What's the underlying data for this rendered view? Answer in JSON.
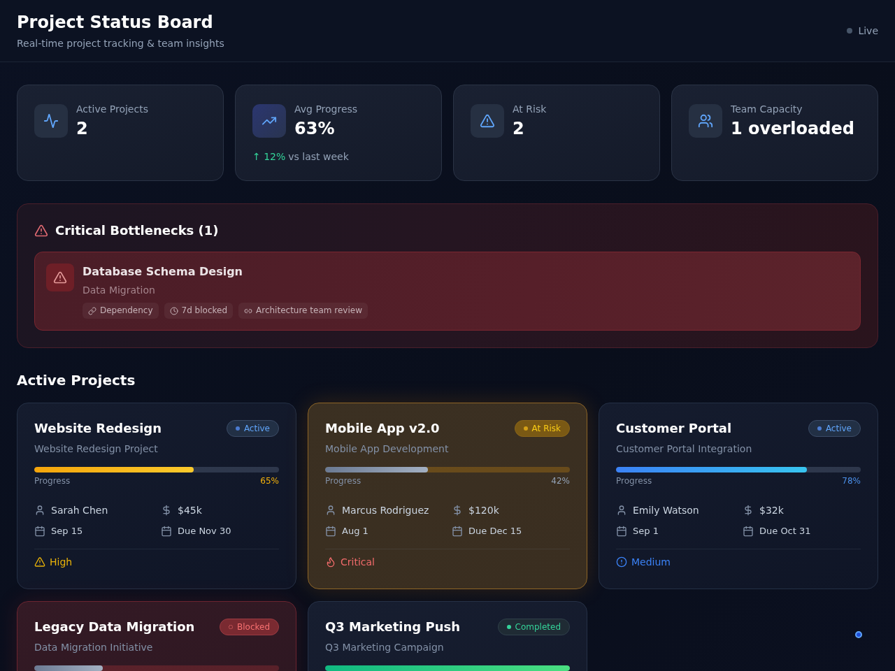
{
  "header": {
    "title": "Project Status Board",
    "subtitle": "Real-time project tracking & team insights",
    "live": {
      "label": "Live",
      "connected": false
    }
  },
  "stats": [
    {
      "kind": "projects",
      "label": "Active Projects",
      "value": "2"
    },
    {
      "kind": "progress",
      "label": "Avg Progress",
      "value": "63%",
      "trend": {
        "change": "↑ 12%",
        "note": "vs last week"
      }
    },
    {
      "kind": "risk",
      "label": "At Risk",
      "value": "2"
    },
    {
      "kind": "capacity",
      "label": "Team Capacity",
      "value": "1 overloaded"
    }
  ],
  "bottlenecks": {
    "title": "Critical Bottlenecks (1)",
    "items": [
      {
        "title": "Database Schema Design",
        "project": "Data Migration",
        "tags": [
          {
            "kind": "dependency",
            "label": "Dependency"
          },
          {
            "kind": "duration",
            "label": "7d blocked"
          },
          {
            "kind": "reviewer",
            "label": "Architecture team review"
          }
        ]
      }
    ]
  },
  "projects_section": {
    "title": "Active Projects",
    "projects": [
      {
        "name": "Website Redesign",
        "description": "Website Redesign Project",
        "status": {
          "kind": "active",
          "label": "Active"
        },
        "progress_label": "Progress",
        "level": 0.65,
        "percent": "65%",
        "owner": "Sarah Chen",
        "budget": "$45k",
        "start": "Sep 15",
        "due": "Due Nov 30",
        "priority": {
          "kind": "high",
          "label": "High"
        }
      },
      {
        "name": "Mobile App v2.0",
        "description": "Mobile App Development",
        "status": {
          "kind": "risk",
          "label": "At Risk"
        },
        "progress_label": "Progress",
        "level": 0.42,
        "percent": "42%",
        "owner": "Marcus Rodriguez",
        "budget": "$120k",
        "start": "Aug 1",
        "due": "Due Dec 15",
        "priority": {
          "kind": "critical",
          "label": "Critical"
        }
      },
      {
        "name": "Customer Portal",
        "description": "Customer Portal Integration",
        "status": {
          "kind": "active",
          "label": "Active"
        },
        "progress_label": "Progress",
        "level": 0.78,
        "percent": "78%",
        "owner": "Emily Watson",
        "budget": "$32k",
        "start": "Sep 1",
        "due": "Due Oct 31",
        "priority": {
          "kind": "medium",
          "label": "Medium"
        }
      },
      {
        "name": "Legacy Data Migration",
        "description": "Data Migration Initiative",
        "status": {
          "kind": "blocked",
          "label": "Blocked"
        },
        "level": 0.28
      },
      {
        "name": "Q3 Marketing Push",
        "description": "Q3 Marketing Campaign",
        "status": {
          "kind": "completed",
          "label": "Completed"
        },
        "level": 1
      }
    ]
  }
}
